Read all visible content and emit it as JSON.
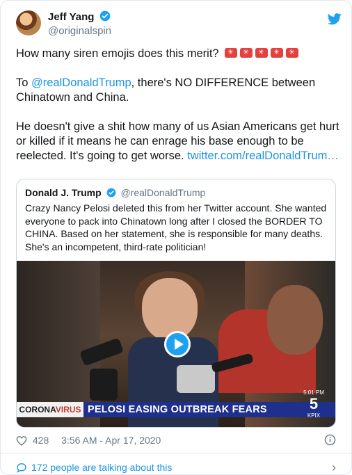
{
  "author": {
    "display_name": "Jeff Yang",
    "handle": "@originalspin",
    "verified_icon": "verified-badge-icon",
    "network_icon": "twitter-bird-icon"
  },
  "tweet": {
    "p1_text": "How many siren emojis does this merit?",
    "siren_count": 5,
    "p2_prefix": "To ",
    "p2_mention": "@realDonaldTrump",
    "p2_rest": ", there's NO DIFFERENCE between Chinatown and China.",
    "p3_text": "He doesn't give a shit how many of us Asian Americans get hurt or killed if it means he can enrage his base enough to be reelected. It's going to get worse. ",
    "p3_link": "twitter.com/realDonaldTrum…"
  },
  "quoted_tweet": {
    "display_name": "Donald J. Trump",
    "handle": "@realDonaldTrump",
    "text": "Crazy Nancy Pelosi deleted this from her Twitter account. She wanted everyone to pack into Chinatown long after I closed the BORDER TO CHINA. Based on her statement, she is responsible for many deaths. She's an incompetent, third-rate politician!",
    "video": {
      "banner_part1": "CORONA",
      "banner_part2": "VIRUS",
      "headline": "PELOSI EASING OUTBREAK FEARS",
      "station_time": "5:01 PM",
      "station_num": "5",
      "station_name": "KPIX"
    }
  },
  "meta": {
    "likes": "428",
    "timestamp": "3:56 AM - Apr 17, 2020"
  },
  "footer": {
    "talking": "172 people are talking about this"
  },
  "colors": {
    "accent": "#1da1f2",
    "link": "#1b95e0",
    "muted": "#657786",
    "siren": "#e4403e"
  }
}
